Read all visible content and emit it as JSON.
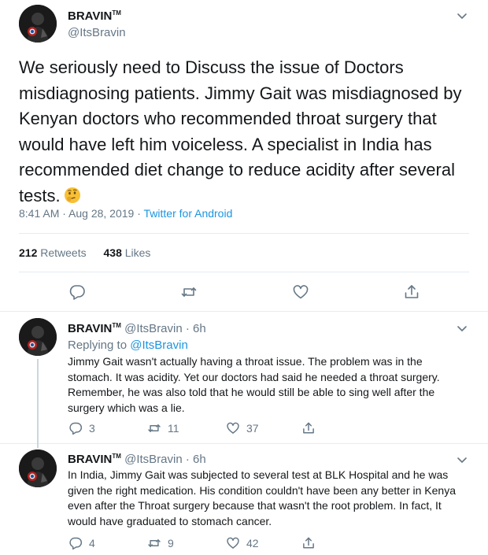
{
  "main_tweet": {
    "display_name": "BRAVIN",
    "tm": "TM",
    "handle": "@ItsBravin",
    "text": "We seriously need to Discuss the issue of Doctors misdiagnosing patients. Jimmy Gait was misdiagnosed by Kenyan doctors who recommended throat surgery that would have left him voiceless. A specialist in India has recommended diet change to reduce acidity after several tests.",
    "emoji": "thinking-face-emoji",
    "time": "8:41 AM · Aug 28, 2019 · ",
    "source": "Twitter for Android",
    "retweets_count": "212",
    "retweets_label": " Retweets",
    "likes_count": "438",
    "likes_label": " Likes"
  },
  "replies": [
    {
      "display_name": "BRAVIN",
      "tm": "TM",
      "handle_time": " @ItsBravin · 6h",
      "replying_prefix": "Replying to ",
      "replying_mention": "@ItsBravin",
      "text": "Jimmy Gait wasn't actually having a throat issue. The problem was in the stomach. It was acidity. Yet our doctors had said he needed a throat surgery. Remember, he was also told that he would still be able to sing well after the surgery which was a lie.",
      "reply_count": "3",
      "retweet_count": "11",
      "like_count": "37"
    },
    {
      "display_name": "BRAVIN",
      "tm": "TM",
      "handle_time": " @ItsBravin · 6h",
      "text": "In India, Jimmy Gait was subjected to several test at BLK Hospital and he was given the right medication. His condition couldn't have been any better in Kenya even after the Throat surgery because that wasn't the root problem. In fact, It would have graduated to stomach cancer.",
      "reply_count": "4",
      "retweet_count": "9",
      "like_count": "42"
    }
  ],
  "colors": {
    "link": "#1b95e0",
    "secondary": "#657786",
    "divider": "#e6ecf0",
    "thread_line": "#ccd6dd"
  },
  "icons": {
    "reply": "reply-icon",
    "retweet": "retweet-icon",
    "like": "heart-icon",
    "share": "share-icon",
    "more": "chevron-down-icon"
  }
}
